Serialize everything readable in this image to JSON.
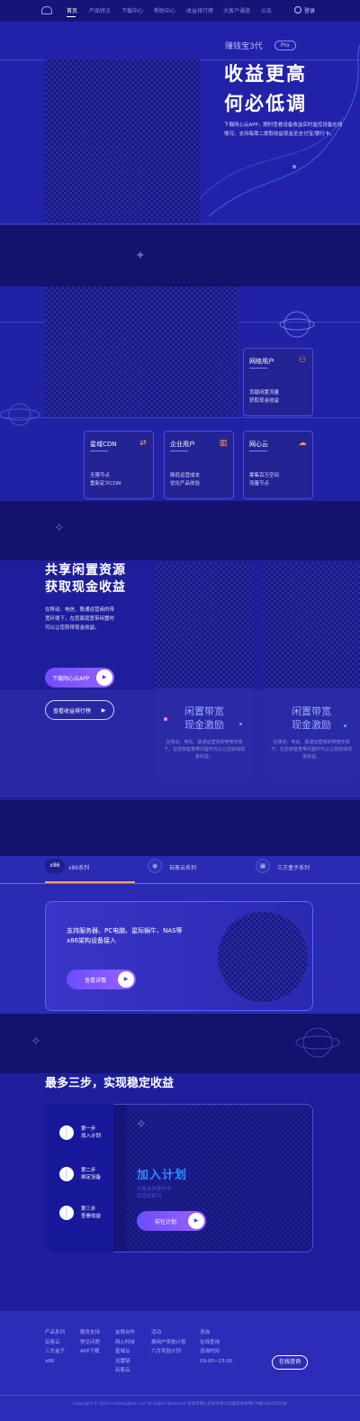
{
  "nav": {
    "items": [
      "首页",
      "产品特点",
      "下载中心",
      "帮助中心",
      "收益排行榜",
      "大客户通道",
      "公告"
    ],
    "login": "登录"
  },
  "hero": {
    "brand": "赚钱宝3代",
    "badge": "Pro",
    "title_line1": "收益更高",
    "title_line2": "何必低调",
    "desc": "下载网心云APP，随时查看设备收益实时监控设备在线情况，支持每周二提取收益现金至支付宝/银行卡。"
  },
  "cards": {
    "network_user": {
      "title": "网络用户",
      "desc1": "贡献闲置流量",
      "desc2": "获取现金收益"
    },
    "cdn": {
      "title": "星域CDN",
      "desc1": "无限节点",
      "desc2": "重新定义CDN"
    },
    "enterprise": {
      "title": "企业用户",
      "desc1": "降低运营成本",
      "desc2": "优化产品体验"
    },
    "cloud": {
      "title": "网心云",
      "desc1": "筹集百万空间",
      "desc2": "流量节点"
    }
  },
  "share": {
    "title_line1": "共享闲置资源",
    "title_line2": "获取现金收益",
    "desc": "在移动、电信、联通运营商的带宽环境下，在您家庭宽带闲置时可以让您获得现金收益。",
    "btn_download": "下载网心云APP",
    "btn_rank": "查看收益排行榜",
    "bw_card1_title1": "闲置带宽",
    "bw_card1_title2": "现金激励",
    "bw_card1_desc": "在移动、电信、联通运营商的带宽环境下，在您家庭宽带闲置时可以让您获得现金收益。",
    "bw_card2_title1": "闲置带宽",
    "bw_card2_title2": "现金激励",
    "bw_card2_desc": "在移动、电信、联通运营商的带宽环境下，在您家庭宽带闲置时可以让您获得现金收益。"
  },
  "tabs": {
    "x86_badge": "x86",
    "x86": "x86系列",
    "wanke": "玩客云系列",
    "third": "三方盒子系列"
  },
  "x86": {
    "desc_line1": "支持服务器、PC电脑、星际蜗牛、NAS等",
    "desc_line2": "x86架构设备接入",
    "btn": "查看详情"
  },
  "steps": {
    "title": "最多三步，实现稳定收益",
    "step1_a": "第一步",
    "step1_b": "加入计划",
    "step2_a": "第二步",
    "step2_b": "绑定设备",
    "step3_a": "第三步",
    "step3_b": "查看收益",
    "join_title": "加入计划",
    "join_sub1": "注册会员参与不",
    "join_sub2": "同活动即可",
    "join_btn": "前往计划"
  },
  "footer": {
    "col1": [
      "产品系列",
      "玩客云",
      "三方盒子",
      "x86"
    ],
    "col2": [
      "服务支持",
      "常见问题",
      "APP下载"
    ],
    "col3": [
      "友情合作",
      "网心科技",
      "星域云",
      "迅雷链",
      "玩客云"
    ],
    "col4": [
      "活动",
      "拥用户奖励计划",
      "六月奖励计划"
    ],
    "col5": [
      "咨询",
      "在线查询",
      "",
      "咨询时间",
      "09:00~23:00"
    ],
    "consult_btn": "在线咨询",
    "copyright": "Copyright © 2020 onethingtech.net All Rights Reserved 深圳市网心科技有限公司版权所有粤ICP备14035850号"
  }
}
